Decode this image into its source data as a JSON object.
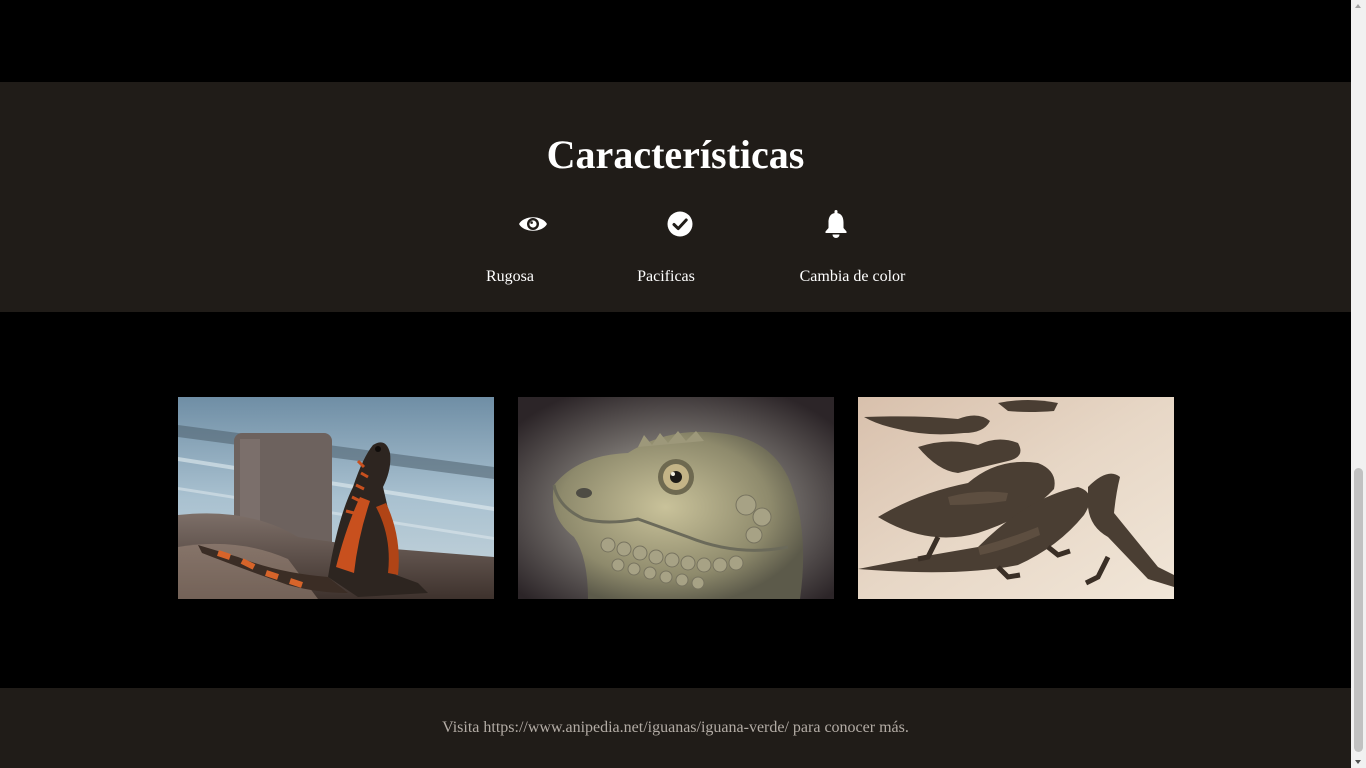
{
  "features": {
    "title": "Características",
    "items": [
      {
        "icon": "eye-icon",
        "label": "Rugosa"
      },
      {
        "icon": "check-circle-icon",
        "label": "Pacificas"
      },
      {
        "icon": "bell-icon",
        "label": "Cambia de color"
      }
    ]
  },
  "gallery": {
    "images": [
      {
        "subject": "iguana-on-rocks-by-water"
      },
      {
        "subject": "iguana-head-closeup"
      },
      {
        "subject": "group-of-iguanas-on-sand"
      }
    ]
  },
  "footer": {
    "text": "Visita https://www.anipedia.net/iguanas/iguana-verde/ para conocer más."
  },
  "colors": {
    "page_background": "#000000",
    "section_background": "#201c18",
    "heading_text": "#ffffff",
    "footer_text": "#b3aca5"
  }
}
